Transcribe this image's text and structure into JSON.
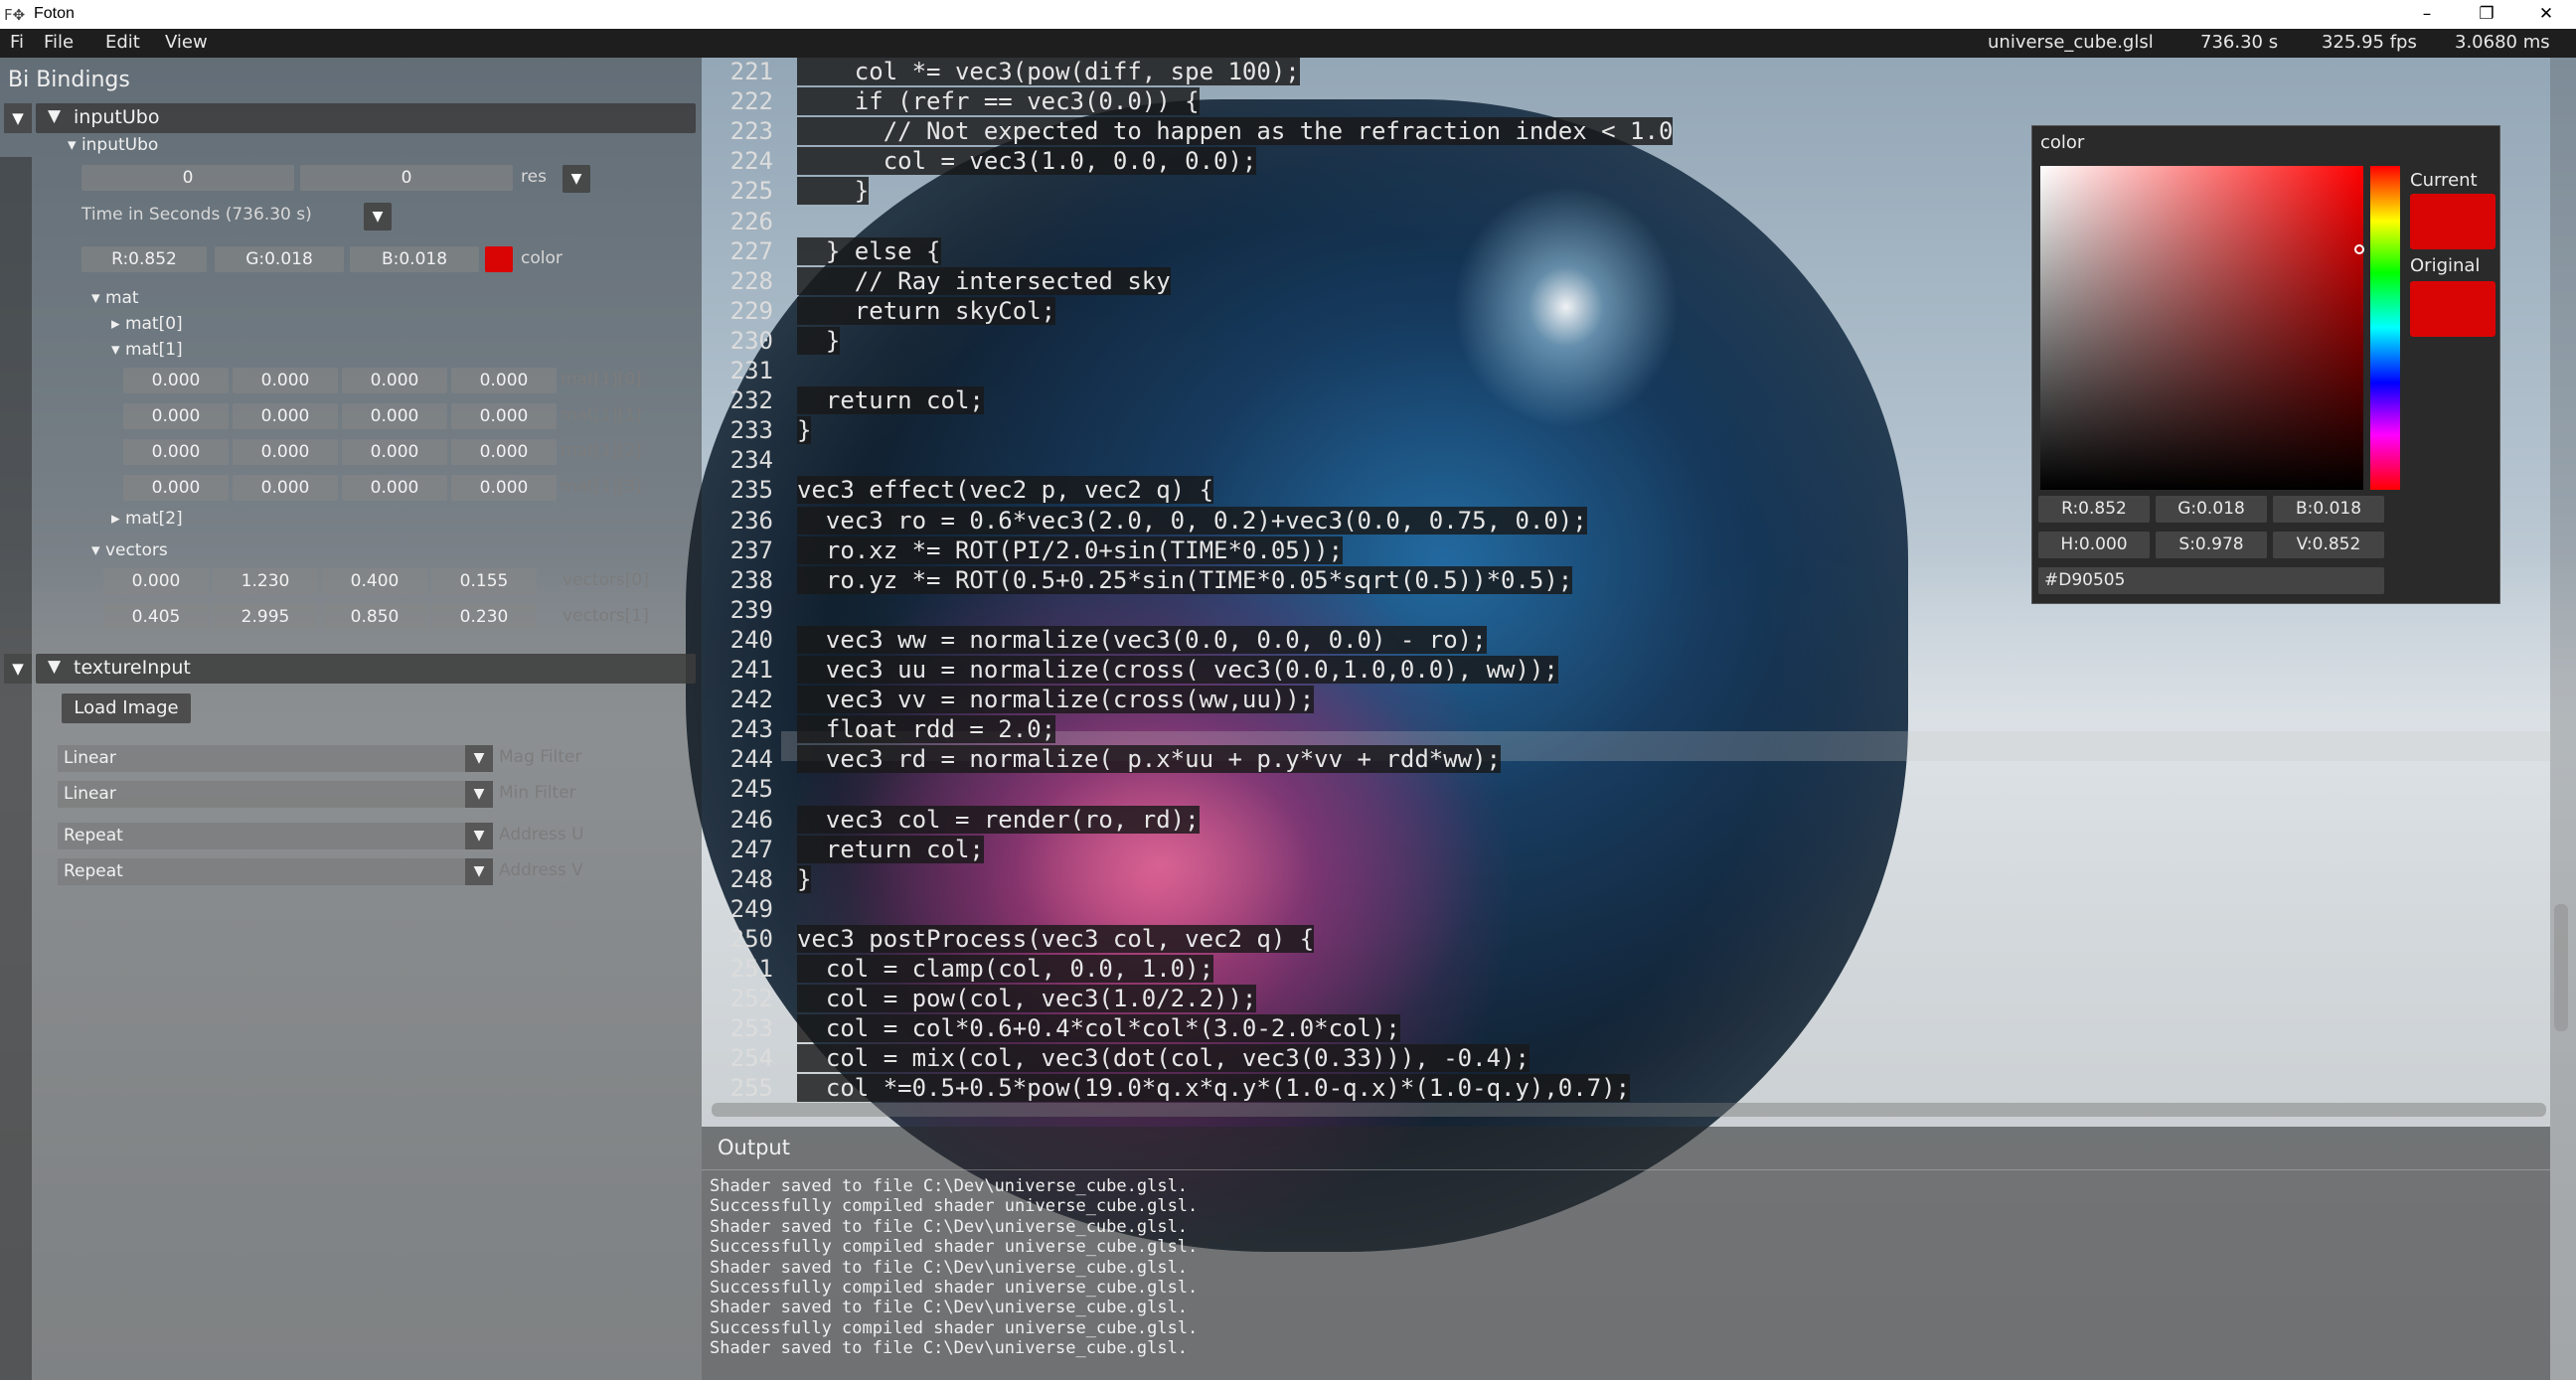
{
  "window": {
    "title": "Foton",
    "controls": [
      "–",
      "❐",
      "✕"
    ]
  },
  "menubar": {
    "items": [
      "Fi",
      "File",
      "Edit",
      "View"
    ],
    "status": {
      "file": "universe_cube.glsl",
      "time": "736.30 s",
      "fps": "325.95 fps",
      "frame_ms": "3.0680 ms"
    }
  },
  "bindings": {
    "tab_cut": "Bi",
    "title": "Bindings",
    "inputUbo": {
      "header": "inputUbo",
      "subheader": "inputUbo",
      "res_values": [
        "0",
        "0"
      ],
      "res_label": "res",
      "time_label": "Time in Seconds (736.30 s)",
      "color_values": [
        "R:0.852",
        "G:0.018",
        "B:0.018"
      ],
      "color_label": "color",
      "color_hex": "#D90505",
      "mat_label": "mat",
      "mat0": "mat[0]",
      "mat1": "mat[1]",
      "mat1_rows": [
        {
          "values": [
            "0.000",
            "0.000",
            "0.000",
            "0.000"
          ],
          "label": "mat[1][0]"
        },
        {
          "values": [
            "0.000",
            "0.000",
            "0.000",
            "0.000"
          ],
          "label": "mat[1][1]"
        },
        {
          "values": [
            "0.000",
            "0.000",
            "0.000",
            "0.000"
          ],
          "label": "mat[1][2]"
        },
        {
          "values": [
            "0.000",
            "0.000",
            "0.000",
            "0.000"
          ],
          "label": "mat[1][3]"
        }
      ],
      "mat2": "mat[2]",
      "vectors_label": "vectors",
      "vectors": [
        {
          "values": [
            "0.000",
            "1.230",
            "0.400",
            "0.155"
          ],
          "label": "vectors[0]"
        },
        {
          "values": [
            "0.405",
            "2.995",
            "0.850",
            "0.230"
          ],
          "label": "vectors[1]"
        }
      ]
    },
    "textureInput": {
      "header": "textureInput",
      "load_button": "Load Image",
      "combos": [
        {
          "value": "Linear",
          "label": "Mag Filter"
        },
        {
          "value": "Linear",
          "label": "Min Filter"
        },
        {
          "value": "Repeat",
          "label": "Address U"
        },
        {
          "value": "Repeat",
          "label": "Address V"
        }
      ]
    }
  },
  "editor": {
    "lines": [
      {
        "n": "221",
        "t": "    col *= vec3(pow(diff, spe 100);"
      },
      {
        "n": "222",
        "t": "    if (refr == vec3(0.0)) {"
      },
      {
        "n": "223",
        "t": "      // Not expected to happen as the refraction index < 1.0"
      },
      {
        "n": "224",
        "t": "      col = vec3(1.0, 0.0, 0.0);"
      },
      {
        "n": "225",
        "t": "    }"
      },
      {
        "n": "226",
        "t": ""
      },
      {
        "n": "227",
        "t": "  } else {"
      },
      {
        "n": "228",
        "t": "    // Ray intersected sky"
      },
      {
        "n": "229",
        "t": "    return skyCol;"
      },
      {
        "n": "230",
        "t": "  }"
      },
      {
        "n": "231",
        "t": ""
      },
      {
        "n": "232",
        "t": "  return col;"
      },
      {
        "n": "233",
        "t": "}"
      },
      {
        "n": "234",
        "t": ""
      },
      {
        "n": "235",
        "t": "vec3 effect(vec2 p, vec2 q) {"
      },
      {
        "n": "236",
        "t": "  vec3 ro = 0.6*vec3(2.0, 0, 0.2)+vec3(0.0, 0.75, 0.0);"
      },
      {
        "n": "237",
        "t": "  ro.xz *= ROT(PI/2.0+sin(TIME*0.05));"
      },
      {
        "n": "238",
        "t": "  ro.yz *= ROT(0.5+0.25*sin(TIME*0.05*sqrt(0.5))*0.5);"
      },
      {
        "n": "239",
        "t": ""
      },
      {
        "n": "240",
        "t": "  vec3 ww = normalize(vec3(0.0, 0.0, 0.0) - ro);"
      },
      {
        "n": "241",
        "t": "  vec3 uu = normalize(cross( vec3(0.0,1.0,0.0), ww));"
      },
      {
        "n": "242",
        "t": "  vec3 vv = normalize(cross(ww,uu));"
      },
      {
        "n": "243",
        "t": "  float rdd = 2.0;"
      },
      {
        "n": "244",
        "t": "  vec3 rd = normalize( p.x*uu + p.y*vv + rdd*ww);"
      },
      {
        "n": "245",
        "t": ""
      },
      {
        "n": "246",
        "t": "  vec3 col = render(ro, rd);"
      },
      {
        "n": "247",
        "t": "  return col;"
      },
      {
        "n": "248",
        "t": "}"
      },
      {
        "n": "249",
        "t": ""
      },
      {
        "n": "250",
        "t": "vec3 postProcess(vec3 col, vec2 q) {"
      },
      {
        "n": "251",
        "t": "  col = clamp(col, 0.0, 1.0);"
      },
      {
        "n": "252",
        "t": "  col = pow(col, vec3(1.0/2.2));"
      },
      {
        "n": "253",
        "t": "  col = col*0.6+0.4*col*col*(3.0-2.0*col);"
      },
      {
        "n": "254",
        "t": "  col = mix(col, vec3(dot(col, vec3(0.33))), -0.4);"
      },
      {
        "n": "255",
        "t": "  col *=0.5+0.5*pow(19.0*q.x*q.y*(1.0-q.x)*(1.0-q.y),0.7);"
      }
    ]
  },
  "output": {
    "title": "Output",
    "lines": [
      "Shader saved to file C:\\Dev\\universe_cube.glsl.",
      "Successfully compiled shader universe_cube.glsl.",
      "Shader saved to file C:\\Dev\\universe_cube.glsl.",
      "Successfully compiled shader universe_cube.glsl.",
      "Shader saved to file C:\\Dev\\universe_cube.glsl.",
      "Successfully compiled shader universe_cube.glsl.",
      "Shader saved to file C:\\Dev\\universe_cube.glsl.",
      "Successfully compiled shader universe_cube.glsl.",
      "Shader saved to file C:\\Dev\\universe_cube.glsl."
    ]
  },
  "color_picker": {
    "title": "color",
    "current_label": "Current",
    "original_label": "Original",
    "current_color": "#D90505",
    "original_color": "#D90505",
    "rgb": [
      "R:0.852",
      "G:0.018",
      "B:0.018"
    ],
    "hsv": [
      "H:0.000",
      "S:0.978",
      "V:0.852"
    ],
    "hex": "#D90505"
  },
  "icons": {
    "collapse": "▼",
    "expand": "▶",
    "dropdown": "▼"
  }
}
